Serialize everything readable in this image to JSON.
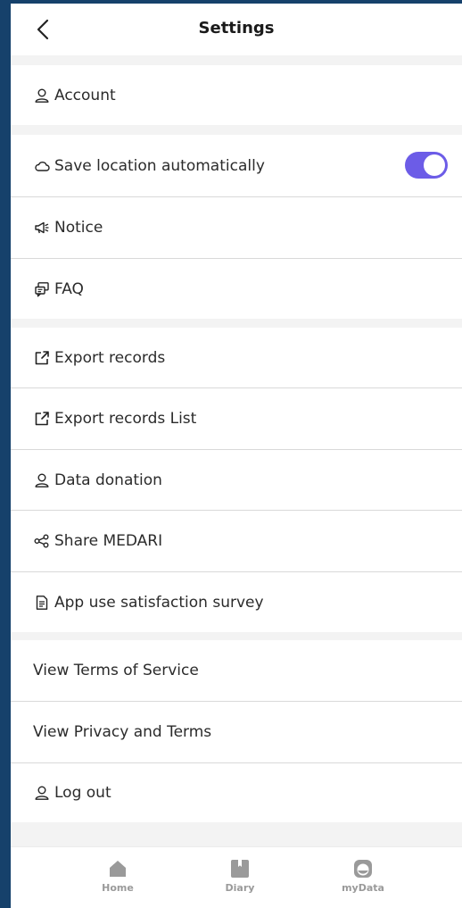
{
  "header": {
    "title": "Settings"
  },
  "items": [
    {
      "label": "Account",
      "icon": "person-icon"
    },
    {
      "label": "Save location automatically",
      "icon": "cloud-icon",
      "toggle_on": true
    },
    {
      "label": "Notice",
      "icon": "megaphone-icon"
    },
    {
      "label": "FAQ",
      "icon": "faq-icon"
    },
    {
      "label": "Export records",
      "icon": "export-icon"
    },
    {
      "label": "Export records List",
      "icon": "export-icon"
    },
    {
      "label": "Data donation",
      "icon": "person-icon"
    },
    {
      "label": "Share MEDARI",
      "icon": "share-icon"
    },
    {
      "label": "App use satisfaction survey",
      "icon": "document-icon"
    },
    {
      "label": "View Terms of Service"
    },
    {
      "label": "View Privacy and Terms"
    },
    {
      "label": "Log out",
      "icon": "person-icon"
    }
  ],
  "tabbar": {
    "tabs": [
      {
        "label": "Home",
        "icon": "home-icon"
      },
      {
        "label": "Diary",
        "icon": "diary-icon"
      },
      {
        "label": "myData",
        "icon": "mydata-icon"
      }
    ]
  },
  "colors": {
    "accent": "#6c5ce7",
    "frame": "#16416b",
    "section_gap": "#f3f3f3",
    "tab_inactive": "#9a9a9a"
  }
}
